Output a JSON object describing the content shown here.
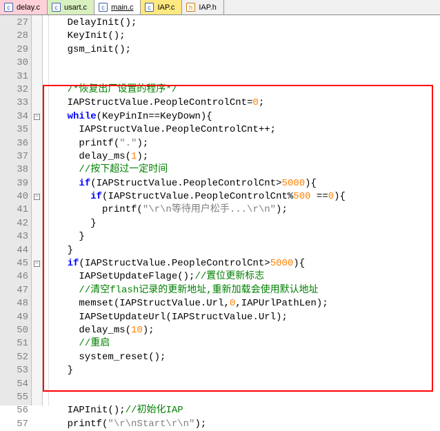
{
  "tabs": [
    {
      "label": "delay.c",
      "cls": "tab-pink",
      "icon": "c",
      "name": "tab-delay-c"
    },
    {
      "label": "usart.c",
      "cls": "tab-green",
      "icon": "c",
      "name": "tab-usart-c"
    },
    {
      "label": "main.c",
      "cls": "tab-main tab-source",
      "icon": "c",
      "name": "tab-main-c"
    },
    {
      "label": "IAP.c",
      "cls": "tab-yellow",
      "icon": "c",
      "name": "tab-iap-c"
    },
    {
      "label": "IAP.h",
      "cls": "tab-header",
      "icon": "h",
      "name": "tab-iap-h"
    }
  ],
  "lines": [
    {
      "n": 27,
      "tok": [
        [
          "    DelayInit",
          "p"
        ],
        [
          "()",
          "p"
        ],
        [
          ";",
          "p"
        ]
      ]
    },
    {
      "n": 28,
      "tok": [
        [
          "    KeyInit",
          "p"
        ],
        [
          "()",
          "p"
        ],
        [
          ";",
          "p"
        ]
      ]
    },
    {
      "n": 29,
      "tok": [
        [
          "    gsm_init",
          "p"
        ],
        [
          "()",
          "p"
        ],
        [
          ";",
          "p"
        ]
      ]
    },
    {
      "n": 30,
      "tok": [
        [
          "",
          "p"
        ]
      ]
    },
    {
      "n": 31,
      "tok": [
        [
          "",
          "p"
        ]
      ]
    },
    {
      "n": 32,
      "tok": [
        [
          "    ",
          "p"
        ],
        [
          "/*恢复出厂设置的程序*/",
          "c"
        ]
      ]
    },
    {
      "n": 33,
      "tok": [
        [
          "    IAPStructValue",
          "p"
        ],
        [
          ".",
          "p"
        ],
        [
          "PeopleControlCnt",
          "p"
        ],
        [
          "=",
          "p"
        ],
        [
          "0",
          "n"
        ],
        [
          ";",
          "p"
        ]
      ]
    },
    {
      "n": 34,
      "fold": "minus",
      "tok": [
        [
          "    ",
          "p"
        ],
        [
          "while",
          "k"
        ],
        [
          "(",
          "p"
        ],
        [
          "KeyPinIn",
          "p"
        ],
        [
          "==",
          "p"
        ],
        [
          "KeyDown",
          "p"
        ],
        [
          ")",
          "p"
        ],
        [
          "{",
          "p"
        ]
      ]
    },
    {
      "n": 35,
      "tok": [
        [
          "      IAPStructValue",
          "p"
        ],
        [
          ".",
          "p"
        ],
        [
          "PeopleControlCnt",
          "p"
        ],
        [
          "++",
          "p"
        ],
        [
          ";",
          "p"
        ]
      ]
    },
    {
      "n": 36,
      "tok": [
        [
          "      printf",
          "p"
        ],
        [
          "(",
          "p"
        ],
        [
          "\".\"",
          "s"
        ],
        [
          ")",
          "p"
        ],
        [
          ";",
          "p"
        ]
      ]
    },
    {
      "n": 37,
      "tok": [
        [
          "      delay_ms",
          "p"
        ],
        [
          "(",
          "p"
        ],
        [
          "1",
          "n"
        ],
        [
          ")",
          "p"
        ],
        [
          ";",
          "p"
        ]
      ]
    },
    {
      "n": 38,
      "tok": [
        [
          "      ",
          "p"
        ],
        [
          "//按下超过一定时间",
          "c"
        ]
      ]
    },
    {
      "n": 39,
      "tok": [
        [
          "      ",
          "p"
        ],
        [
          "if",
          "k"
        ],
        [
          "(",
          "p"
        ],
        [
          "IAPStructValue",
          "p"
        ],
        [
          ".",
          "p"
        ],
        [
          "PeopleControlCnt",
          "p"
        ],
        [
          ">",
          "p"
        ],
        [
          "5000",
          "n"
        ],
        [
          ")",
          "p"
        ],
        [
          "{",
          "p"
        ]
      ]
    },
    {
      "n": 40,
      "fold": "minus",
      "tok": [
        [
          "        ",
          "p"
        ],
        [
          "if",
          "k"
        ],
        [
          "(",
          "p"
        ],
        [
          "IAPStructValue",
          "p"
        ],
        [
          ".",
          "p"
        ],
        [
          "PeopleControlCnt",
          "p"
        ],
        [
          "%",
          "p"
        ],
        [
          "500",
          "n"
        ],
        [
          " ==",
          "p"
        ],
        [
          "0",
          "n"
        ],
        [
          ")",
          "p"
        ],
        [
          "{",
          "p"
        ]
      ]
    },
    {
      "n": 41,
      "tok": [
        [
          "          printf",
          "p"
        ],
        [
          "(",
          "p"
        ],
        [
          "\"\\r\\n等待用户松手...\\r\\n\"",
          "s"
        ],
        [
          ")",
          "p"
        ],
        [
          ";",
          "p"
        ]
      ]
    },
    {
      "n": 42,
      "tok": [
        [
          "        }",
          "p"
        ]
      ]
    },
    {
      "n": 43,
      "tok": [
        [
          "      }",
          "p"
        ]
      ]
    },
    {
      "n": 44,
      "tok": [
        [
          "    }",
          "p"
        ]
      ]
    },
    {
      "n": 45,
      "fold": "minus",
      "tok": [
        [
          "    ",
          "p"
        ],
        [
          "if",
          "k"
        ],
        [
          "(",
          "p"
        ],
        [
          "IAPStructValue",
          "p"
        ],
        [
          ".",
          "p"
        ],
        [
          "PeopleControlCnt",
          "p"
        ],
        [
          ">",
          "p"
        ],
        [
          "5000",
          "n"
        ],
        [
          ")",
          "p"
        ],
        [
          "{",
          "p"
        ]
      ]
    },
    {
      "n": 46,
      "tok": [
        [
          "      IAPSetUpdateFlage",
          "p"
        ],
        [
          "()",
          "p"
        ],
        [
          ";",
          "p"
        ],
        [
          "//置位更新标志",
          "c"
        ]
      ]
    },
    {
      "n": 47,
      "tok": [
        [
          "      ",
          "p"
        ],
        [
          "//清空flash记录的更新地址,重新加载会使用默认地址",
          "c"
        ]
      ]
    },
    {
      "n": 48,
      "tok": [
        [
          "      memset",
          "p"
        ],
        [
          "(",
          "p"
        ],
        [
          "IAPStructValue",
          "p"
        ],
        [
          ".",
          "p"
        ],
        [
          "Url",
          "p"
        ],
        [
          ",",
          "p"
        ],
        [
          "0",
          "n"
        ],
        [
          ",",
          "p"
        ],
        [
          "IAPUrlPathLen",
          "p"
        ],
        [
          ")",
          "p"
        ],
        [
          ";",
          "p"
        ]
      ]
    },
    {
      "n": 49,
      "tok": [
        [
          "      IAPSetUpdateUrl",
          "p"
        ],
        [
          "(",
          "p"
        ],
        [
          "IAPStructValue",
          "p"
        ],
        [
          ".",
          "p"
        ],
        [
          "Url",
          "p"
        ],
        [
          ")",
          "p"
        ],
        [
          ";",
          "p"
        ]
      ]
    },
    {
      "n": 50,
      "tok": [
        [
          "      delay_ms",
          "p"
        ],
        [
          "(",
          "p"
        ],
        [
          "10",
          "n"
        ],
        [
          ")",
          "p"
        ],
        [
          ";",
          "p"
        ]
      ]
    },
    {
      "n": 51,
      "tok": [
        [
          "      ",
          "p"
        ],
        [
          "//重启",
          "c"
        ]
      ]
    },
    {
      "n": 52,
      "tok": [
        [
          "      system_reset",
          "p"
        ],
        [
          "()",
          "p"
        ],
        [
          ";",
          "p"
        ]
      ]
    },
    {
      "n": 53,
      "tok": [
        [
          "    }",
          "p"
        ]
      ]
    },
    {
      "n": 54,
      "tok": [
        [
          "",
          "p"
        ]
      ]
    },
    {
      "n": 55,
      "tok": [
        [
          "",
          "p"
        ]
      ]
    },
    {
      "n": 56,
      "tok": [
        [
          "    IAPInit",
          "p"
        ],
        [
          "()",
          "p"
        ],
        [
          ";",
          "p"
        ],
        [
          "//初始化IAP",
          "c"
        ]
      ]
    },
    {
      "n": 57,
      "tok": [
        [
          "    printf",
          "p"
        ],
        [
          "(",
          "p"
        ],
        [
          "\"\\r\\nStart\\r\\n\"",
          "s"
        ],
        [
          ")",
          "p"
        ],
        [
          ";",
          "p"
        ]
      ]
    }
  ],
  "fold_minus": "−"
}
